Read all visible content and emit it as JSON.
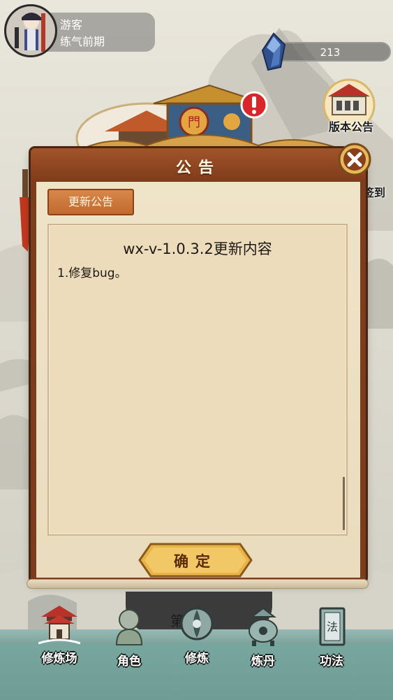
{
  "player": {
    "name": "游客",
    "realm": "练气前期"
  },
  "currency": {
    "icon": "spirit-crystal-icon",
    "amount": "213"
  },
  "side_buttons": {
    "notice_label": "版本公告",
    "checkin_label": "签到"
  },
  "modal": {
    "title": "公告",
    "tab_label": "更新公告",
    "content_title": "wx-v-1.0.3.2更新内容",
    "content_lines": [
      "1.修复bug。"
    ],
    "confirm_label": "确定"
  },
  "bottom_nav": {
    "hub_text": "第",
    "items": [
      {
        "label": "修炼场",
        "icon": "cultivation-field-icon"
      },
      {
        "label": "角色",
        "icon": "character-icon"
      },
      {
        "label": "修炼",
        "icon": "cultivate-icon"
      },
      {
        "label": "炼丹",
        "icon": "alchemy-icon"
      },
      {
        "label": "功法",
        "icon": "technique-book-icon"
      }
    ]
  },
  "colors": {
    "frame": "#7a3d1d",
    "parchment": "#eddcbc",
    "button_gold": "#e8b44a",
    "alert_red": "#d9262b"
  }
}
